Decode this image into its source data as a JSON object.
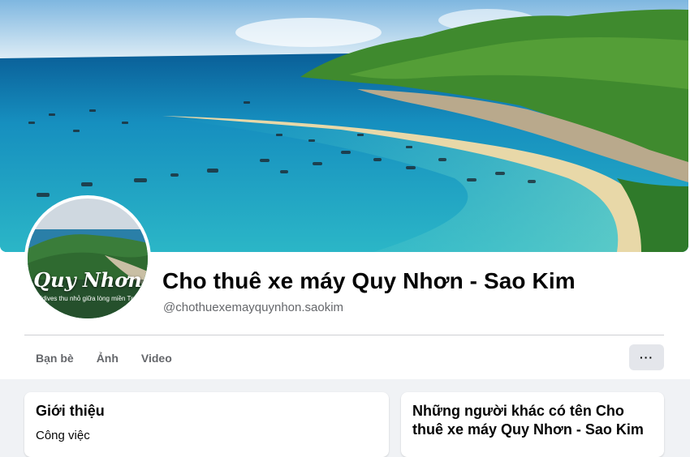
{
  "cover": {
    "description_icon": "cover-photo"
  },
  "avatar": {
    "title": "Quy Nhơn",
    "subtitle": "Maldives thu nhỏ giữa lòng miền Trung"
  },
  "page": {
    "name": "Cho thuê xe máy Quy Nhơn - Sao Kim",
    "handle": "@chothuexemayquynhon.saokim"
  },
  "tabs": [
    {
      "label": "Bạn bè"
    },
    {
      "label": "Ảnh"
    },
    {
      "label": "Video"
    }
  ],
  "more_button": {
    "label": "···",
    "icon": "more-horizontal-icon"
  },
  "intro": {
    "title": "Giới thiệu",
    "first_item": "Công việc"
  },
  "similar": {
    "title": "Những người khác có tên Cho thuê xe máy Quy Nhơn - Sao Kim"
  },
  "colors": {
    "background": "#f0f2f5",
    "secondary_text": "#65676b",
    "button_bg": "#e4e6eb",
    "sea": "#1aa6c4",
    "hill": "#3f8a2e"
  }
}
